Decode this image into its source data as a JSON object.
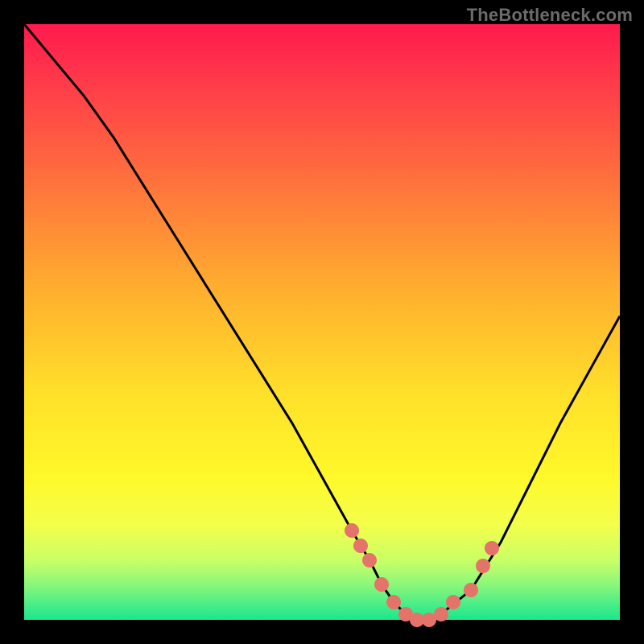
{
  "watermark": "TheBottleneck.com",
  "colors": {
    "frame": "#000000",
    "dot": "#e4746a",
    "curve": "#000000",
    "gradient_top": "#ff1a4d",
    "gradient_bottom": "#19e88f"
  },
  "chart_data": {
    "type": "line",
    "title": "",
    "xlabel": "",
    "ylabel": "",
    "xlim": [
      0,
      100
    ],
    "ylim": [
      0,
      100
    ],
    "grid": false,
    "legend": false,
    "series": [
      {
        "name": "bottleneck-curve",
        "x": [
          0,
          5,
          10,
          15,
          20,
          25,
          30,
          35,
          40,
          45,
          50,
          55,
          58,
          60,
          62,
          64,
          66,
          68,
          70,
          75,
          80,
          85,
          90,
          95,
          100
        ],
        "values": [
          100,
          94,
          88,
          81,
          73,
          65,
          57,
          49,
          41,
          33,
          24,
          15,
          10,
          6,
          3,
          1,
          0,
          0,
          1,
          5,
          13,
          23,
          33,
          42,
          51
        ]
      }
    ],
    "markers": {
      "name": "highlighted-points",
      "x": [
        55,
        56.5,
        58,
        60,
        62,
        64,
        66,
        68,
        70,
        72,
        75,
        77,
        78.5
      ],
      "values": [
        15,
        12.5,
        10,
        6,
        3,
        1,
        0,
        0,
        1,
        3,
        5,
        9,
        12
      ]
    }
  }
}
